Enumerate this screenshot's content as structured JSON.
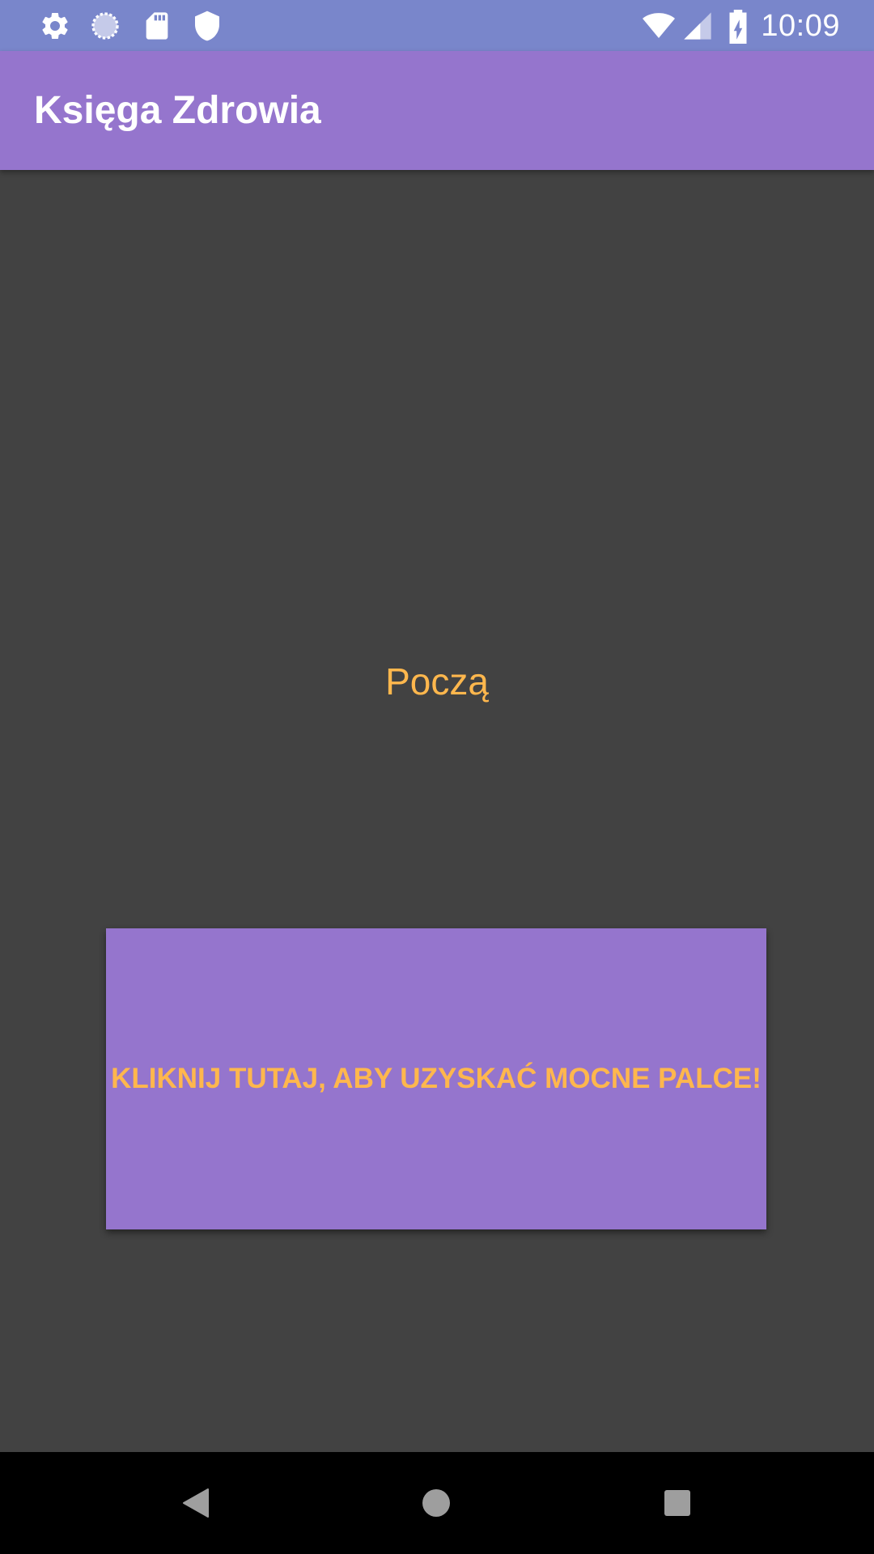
{
  "status_bar": {
    "time": "10:09",
    "left_icons": [
      "gear-icon",
      "sync-circle-icon",
      "sd-card-icon",
      "shield-icon"
    ],
    "right_icons": [
      "wifi-icon",
      "cell-signal-icon",
      "battery-charging-icon"
    ],
    "background_color": "#7986cb"
  },
  "app_bar": {
    "title": "Księga Zdrowia",
    "background_color": "#9575cd"
  },
  "main": {
    "label": "Począ",
    "label_color": "#ffb74d",
    "background_color": "#424242",
    "button": {
      "label": "KLIKNIJ TUTAJ, ABY UZYSKAĆ MOCNE PALCE!",
      "background_color": "#9575cd",
      "text_color": "#ffb74d"
    }
  },
  "nav_bar": {
    "buttons": [
      "back-icon",
      "home-icon",
      "recents-icon"
    ]
  }
}
